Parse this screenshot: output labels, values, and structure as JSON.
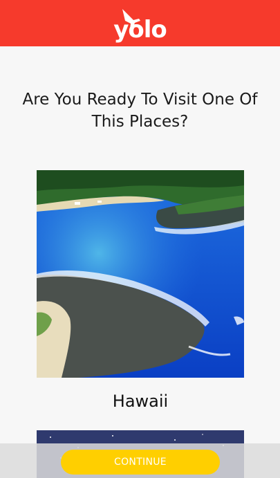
{
  "header": {
    "logo_text": "yolo",
    "logo_icon": "airplane-icon",
    "background": "#f63a2c"
  },
  "main": {
    "heading": "Are You Ready To Visit One Of This Places?",
    "places": [
      {
        "name": "Hawaii",
        "image": "hawaii-coast-photo"
      },
      {
        "name": "",
        "image": "starry-sky-photo"
      }
    ]
  },
  "footer": {
    "continue_label": "CONTINUE",
    "button_color": "#ffcf00"
  }
}
